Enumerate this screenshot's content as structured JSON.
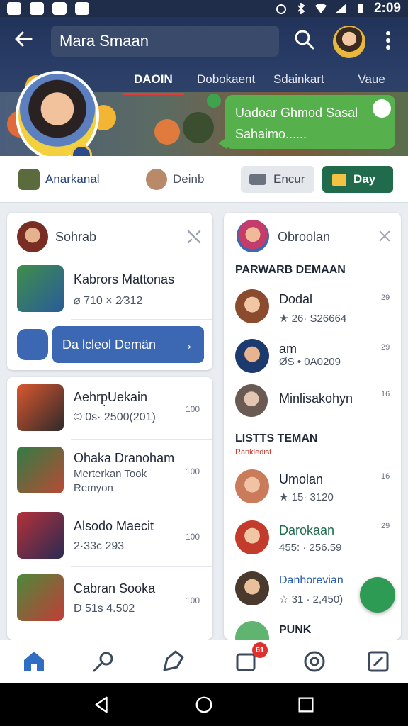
{
  "status_bar": {
    "time": "2:09"
  },
  "header": {
    "search_value": "Mara Smaan",
    "tabs": [
      {
        "label": "DAOIN",
        "active": true
      },
      {
        "label": "Dobokaent"
      },
      {
        "label": "Sdainkart"
      },
      {
        "label": "Vaue"
      }
    ],
    "bubble_line1": "Uadoar Ghmod Sasal",
    "bubble_line2": "Sahaimo......"
  },
  "actionbar": {
    "item1": "Anarkanal",
    "item2": "Deinb",
    "btn_gray": "Encur",
    "btn_green": "Day"
  },
  "left_top": {
    "title": "Sohrab",
    "item_name": "Kabrors Mattonas",
    "item_meta": "⌀ 710 × 2⁄312",
    "button": "Da lcleol Demän"
  },
  "left_list": [
    {
      "name": "Aehrp̣Uekain",
      "meta": "© 0s· 2500⁢(201)",
      "side": "100"
    },
    {
      "name": "Ohaka Dranoham",
      "meta": "Merterkan Took",
      "meta2": "Remyon",
      "side": "100"
    },
    {
      "name": "Alsodo Maecit",
      "meta": "2·33c 293",
      "side": "100"
    },
    {
      "name": "Cabran Sooka",
      "meta": "Đ 51s 4.502",
      "side": "100"
    }
  ],
  "right": {
    "title": "Obroolan",
    "section1": "PARWARB DEMAAN",
    "people1": [
      {
        "name": "Dodal",
        "meta": "★ 26· S26664",
        "side": "29"
      },
      {
        "name": "am",
        "meta": "ØS • 0A0209",
        "side": "29"
      },
      {
        "name": "Minlisakohyn",
        "meta": "",
        "side": "16"
      }
    ],
    "section2": "LISTTS TEMAN",
    "section2_sub": "Rankledist",
    "people2": [
      {
        "name": "Umolan",
        "meta": "★ 15· 3120",
        "side": "16"
      },
      {
        "name": "Darokaan",
        "meta": "455: · 256.59",
        "side": "29"
      },
      {
        "name": "Danhorevian",
        "meta": "☆ 31 · 2,450)",
        "side": ""
      },
      {
        "name": "PUNK",
        "meta": "",
        "side": ""
      }
    ]
  },
  "bottomnav": {
    "badge": "61"
  },
  "colors": {
    "primary": "#3b67b3",
    "green": "#1f6b4b",
    "header": "#22335a",
    "accent_red": "#e23b3b"
  }
}
